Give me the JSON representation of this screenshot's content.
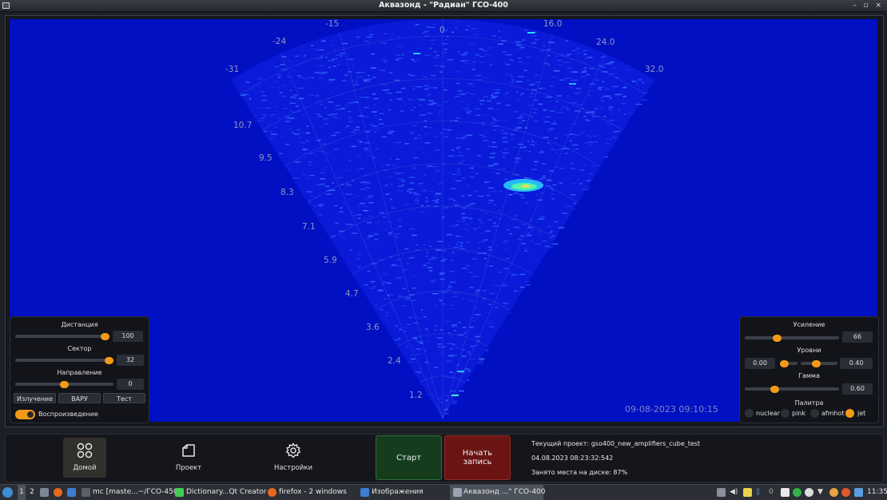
{
  "window": {
    "title": "Аквазонд  - \"Радиан\" ГСО-400",
    "buttons": "– ▫ ×"
  },
  "sonar": {
    "angle_labels": [
      "-31",
      "-24",
      "-15",
      "0",
      "16.0",
      "24.0",
      "32.0"
    ],
    "range_labels": [
      "10.7",
      "9.5",
      "8.3",
      "7.1",
      "5.9",
      "4.7",
      "3.6",
      "2.4",
      "1.2"
    ],
    "timestamp": "09-08-2023 09:10:15",
    "colors": {
      "background": "#0010c2",
      "sector": "#0a1ad8",
      "palette": "jet"
    }
  },
  "left_panel": {
    "distance": {
      "label": "Дистанция",
      "value": "100",
      "level": 1.0
    },
    "sector": {
      "label": "Сектор",
      "value": "32",
      "level": 1.0
    },
    "direction": {
      "label": "Направление",
      "value": "0",
      "level": 0.5
    },
    "buttons": [
      "Излучение",
      "ВАРУ",
      "Тест"
    ],
    "playback": {
      "label": "Воспроизведение",
      "on": true
    }
  },
  "right_panel": {
    "gain": {
      "label": "Усиление",
      "value": "66",
      "level": 0.33
    },
    "levels": {
      "label": "Уровни",
      "low": "0.00",
      "high": "0.40"
    },
    "gamma": {
      "label": "Гамма",
      "value": "0.60",
      "level": 0.3
    },
    "palette": {
      "label": "Палитра",
      "options": [
        "nuclear",
        "pink",
        "afmhot",
        "jet"
      ],
      "selected": "jet"
    }
  },
  "nav": {
    "home": "Домой",
    "project": "Проект",
    "settings": "Настройки"
  },
  "actions": {
    "start": "Старт",
    "record_line1": "Начать",
    "record_line2": "запись"
  },
  "status": {
    "project": "Текущий проект: gso400_new_amplifiers_cube_test",
    "datetime": "04.08.2023  08:23:32:542",
    "disk": "Занято места на диске: 87%"
  },
  "taskbar": {
    "workspaces": [
      "1",
      "2"
    ],
    "tasks": [
      "mc [maste...~/ГСО-450",
      "Dictionary...Qt Creator",
      "firefox - 2 windows",
      "Изображения",
      "Аквазонд ...\" ГСО-400"
    ],
    "tray_number": "0",
    "clock": "11:35"
  }
}
